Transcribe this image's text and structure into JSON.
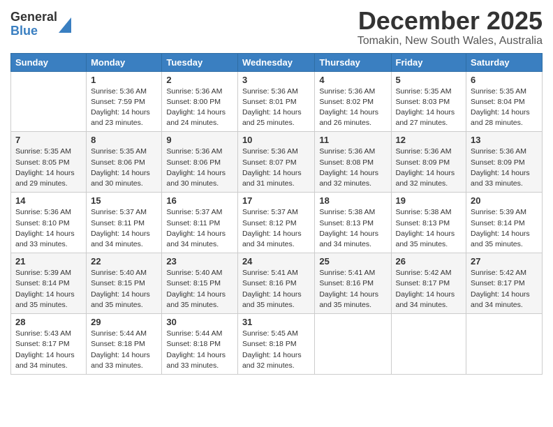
{
  "header": {
    "logo_general": "General",
    "logo_blue": "Blue",
    "month_title": "December 2025",
    "location": "Tomakin, New South Wales, Australia"
  },
  "days_of_week": [
    "Sunday",
    "Monday",
    "Tuesday",
    "Wednesday",
    "Thursday",
    "Friday",
    "Saturday"
  ],
  "weeks": [
    [
      {
        "num": "",
        "info": ""
      },
      {
        "num": "1",
        "info": "Sunrise: 5:36 AM\nSunset: 7:59 PM\nDaylight: 14 hours\nand 23 minutes."
      },
      {
        "num": "2",
        "info": "Sunrise: 5:36 AM\nSunset: 8:00 PM\nDaylight: 14 hours\nand 24 minutes."
      },
      {
        "num": "3",
        "info": "Sunrise: 5:36 AM\nSunset: 8:01 PM\nDaylight: 14 hours\nand 25 minutes."
      },
      {
        "num": "4",
        "info": "Sunrise: 5:36 AM\nSunset: 8:02 PM\nDaylight: 14 hours\nand 26 minutes."
      },
      {
        "num": "5",
        "info": "Sunrise: 5:35 AM\nSunset: 8:03 PM\nDaylight: 14 hours\nand 27 minutes."
      },
      {
        "num": "6",
        "info": "Sunrise: 5:35 AM\nSunset: 8:04 PM\nDaylight: 14 hours\nand 28 minutes."
      }
    ],
    [
      {
        "num": "7",
        "info": "Sunrise: 5:35 AM\nSunset: 8:05 PM\nDaylight: 14 hours\nand 29 minutes."
      },
      {
        "num": "8",
        "info": "Sunrise: 5:35 AM\nSunset: 8:06 PM\nDaylight: 14 hours\nand 30 minutes."
      },
      {
        "num": "9",
        "info": "Sunrise: 5:36 AM\nSunset: 8:06 PM\nDaylight: 14 hours\nand 30 minutes."
      },
      {
        "num": "10",
        "info": "Sunrise: 5:36 AM\nSunset: 8:07 PM\nDaylight: 14 hours\nand 31 minutes."
      },
      {
        "num": "11",
        "info": "Sunrise: 5:36 AM\nSunset: 8:08 PM\nDaylight: 14 hours\nand 32 minutes."
      },
      {
        "num": "12",
        "info": "Sunrise: 5:36 AM\nSunset: 8:09 PM\nDaylight: 14 hours\nand 32 minutes."
      },
      {
        "num": "13",
        "info": "Sunrise: 5:36 AM\nSunset: 8:09 PM\nDaylight: 14 hours\nand 33 minutes."
      }
    ],
    [
      {
        "num": "14",
        "info": "Sunrise: 5:36 AM\nSunset: 8:10 PM\nDaylight: 14 hours\nand 33 minutes."
      },
      {
        "num": "15",
        "info": "Sunrise: 5:37 AM\nSunset: 8:11 PM\nDaylight: 14 hours\nand 34 minutes."
      },
      {
        "num": "16",
        "info": "Sunrise: 5:37 AM\nSunset: 8:11 PM\nDaylight: 14 hours\nand 34 minutes."
      },
      {
        "num": "17",
        "info": "Sunrise: 5:37 AM\nSunset: 8:12 PM\nDaylight: 14 hours\nand 34 minutes."
      },
      {
        "num": "18",
        "info": "Sunrise: 5:38 AM\nSunset: 8:13 PM\nDaylight: 14 hours\nand 34 minutes."
      },
      {
        "num": "19",
        "info": "Sunrise: 5:38 AM\nSunset: 8:13 PM\nDaylight: 14 hours\nand 35 minutes."
      },
      {
        "num": "20",
        "info": "Sunrise: 5:39 AM\nSunset: 8:14 PM\nDaylight: 14 hours\nand 35 minutes."
      }
    ],
    [
      {
        "num": "21",
        "info": "Sunrise: 5:39 AM\nSunset: 8:14 PM\nDaylight: 14 hours\nand 35 minutes."
      },
      {
        "num": "22",
        "info": "Sunrise: 5:40 AM\nSunset: 8:15 PM\nDaylight: 14 hours\nand 35 minutes."
      },
      {
        "num": "23",
        "info": "Sunrise: 5:40 AM\nSunset: 8:15 PM\nDaylight: 14 hours\nand 35 minutes."
      },
      {
        "num": "24",
        "info": "Sunrise: 5:41 AM\nSunset: 8:16 PM\nDaylight: 14 hours\nand 35 minutes."
      },
      {
        "num": "25",
        "info": "Sunrise: 5:41 AM\nSunset: 8:16 PM\nDaylight: 14 hours\nand 35 minutes."
      },
      {
        "num": "26",
        "info": "Sunrise: 5:42 AM\nSunset: 8:17 PM\nDaylight: 14 hours\nand 34 minutes."
      },
      {
        "num": "27",
        "info": "Sunrise: 5:42 AM\nSunset: 8:17 PM\nDaylight: 14 hours\nand 34 minutes."
      }
    ],
    [
      {
        "num": "28",
        "info": "Sunrise: 5:43 AM\nSunset: 8:17 PM\nDaylight: 14 hours\nand 34 minutes."
      },
      {
        "num": "29",
        "info": "Sunrise: 5:44 AM\nSunset: 8:18 PM\nDaylight: 14 hours\nand 33 minutes."
      },
      {
        "num": "30",
        "info": "Sunrise: 5:44 AM\nSunset: 8:18 PM\nDaylight: 14 hours\nand 33 minutes."
      },
      {
        "num": "31",
        "info": "Sunrise: 5:45 AM\nSunset: 8:18 PM\nDaylight: 14 hours\nand 32 minutes."
      },
      {
        "num": "",
        "info": ""
      },
      {
        "num": "",
        "info": ""
      },
      {
        "num": "",
        "info": ""
      }
    ]
  ]
}
